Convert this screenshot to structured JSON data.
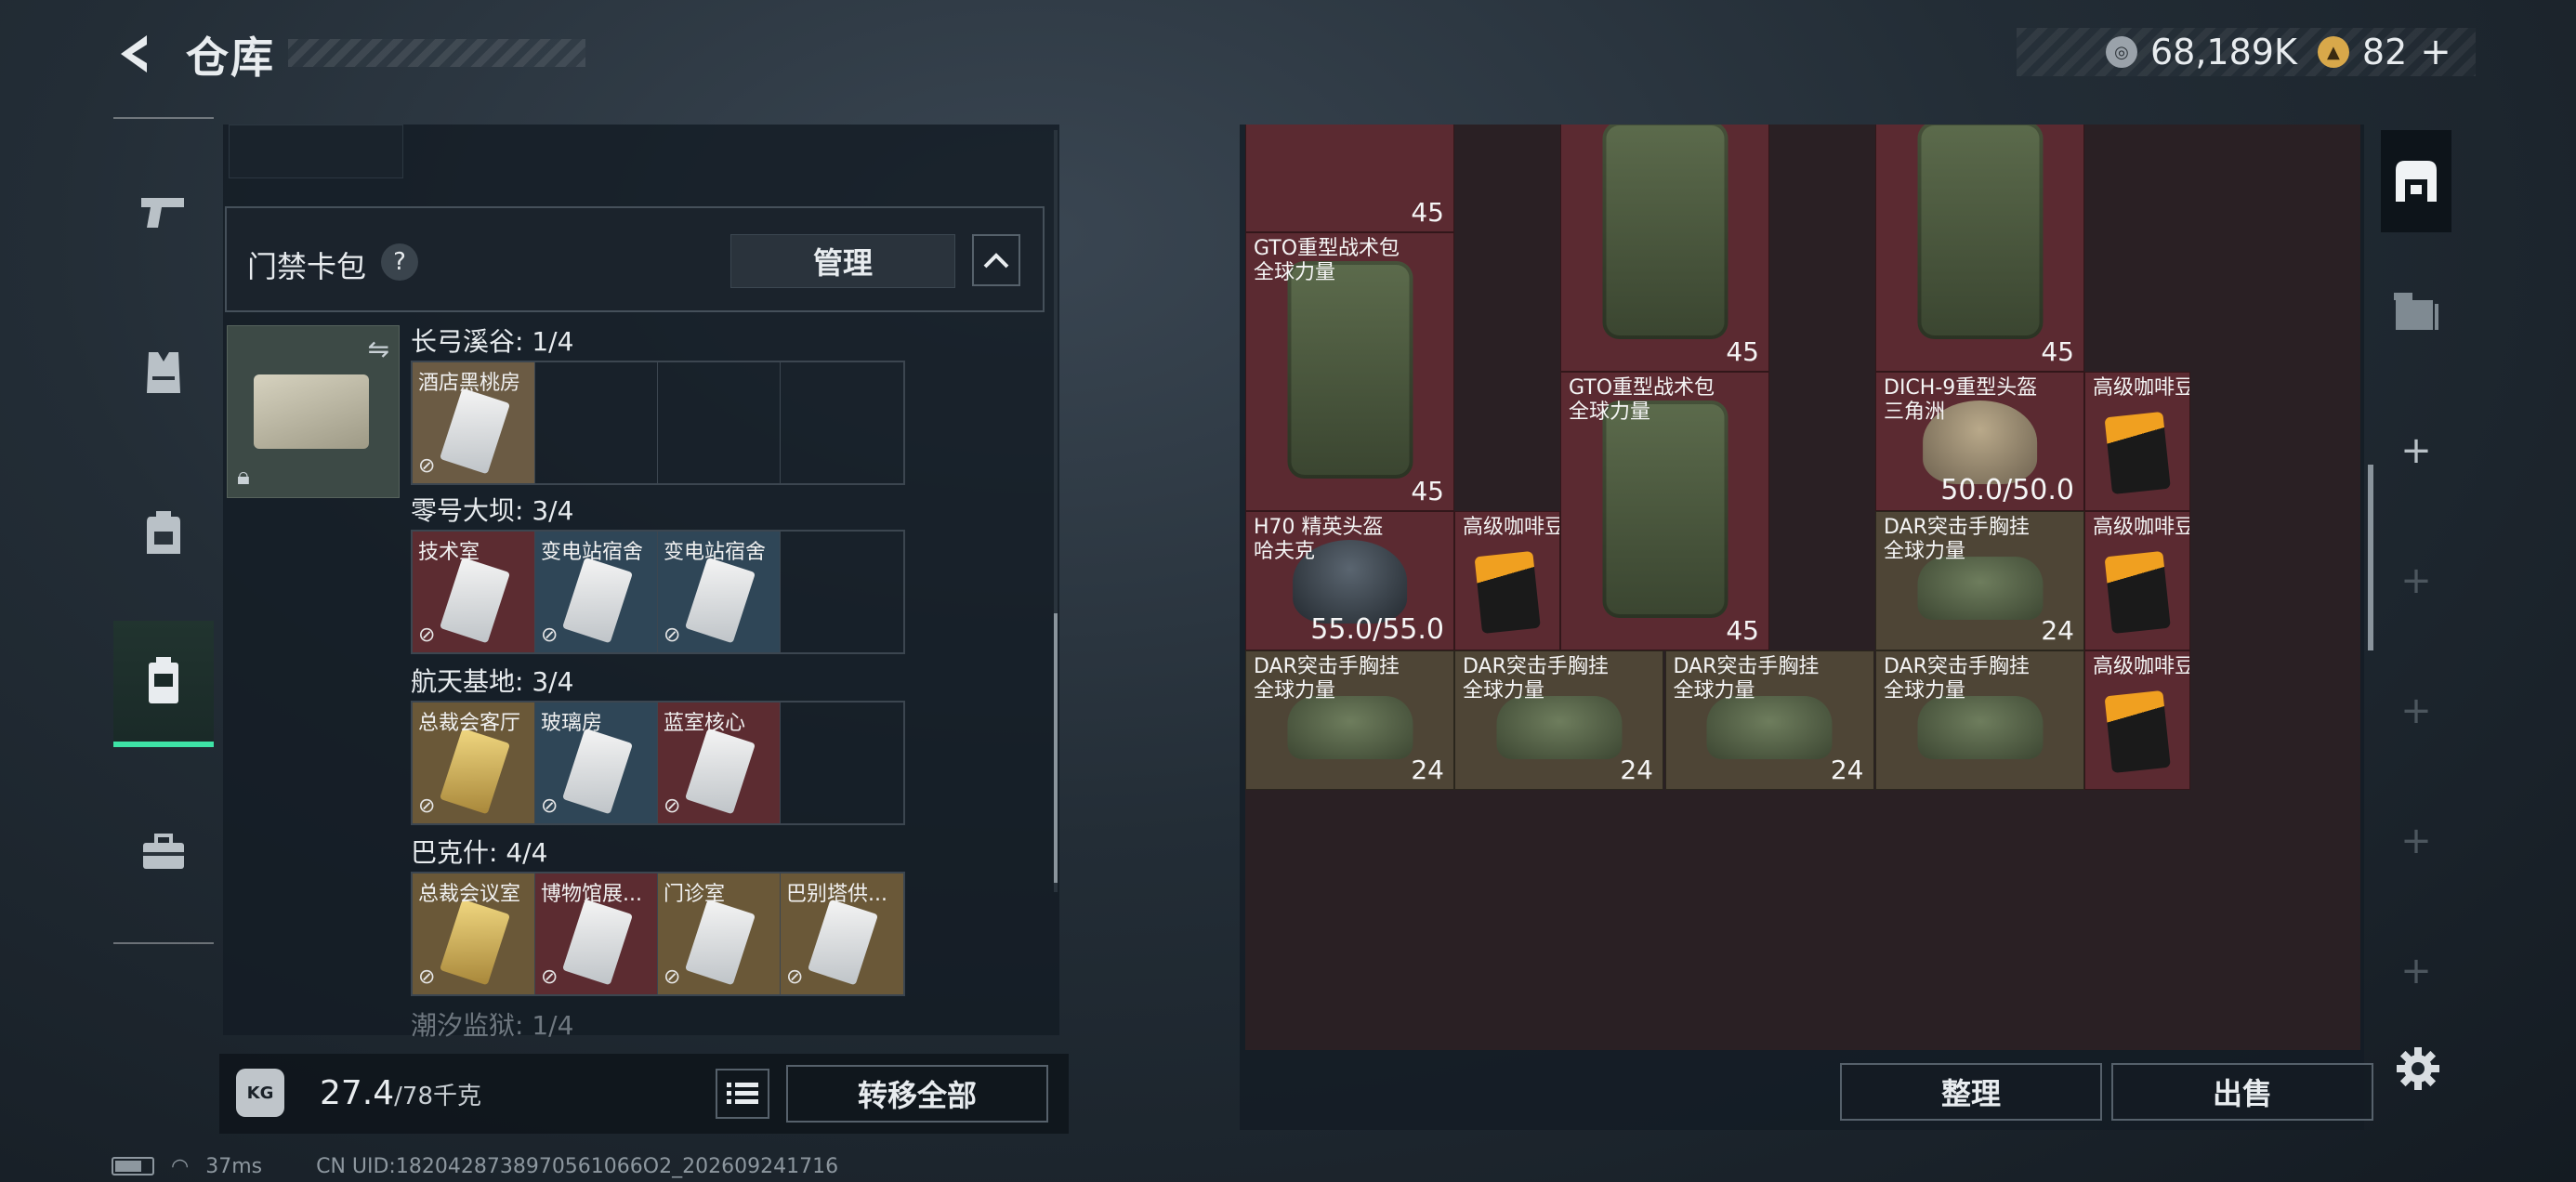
{
  "header": {
    "title": "仓库",
    "currency_1": "68,189K",
    "currency_2": "82",
    "currency_2_add": "+"
  },
  "left_nav": {
    "items": [
      {
        "icon": "pistol-icon"
      },
      {
        "icon": "vest-icon"
      },
      {
        "icon": "backpack-icon"
      },
      {
        "icon": "keycard-case-icon",
        "active": true
      },
      {
        "icon": "toolbox-icon"
      }
    ]
  },
  "keycard": {
    "title": "门禁卡包",
    "help": "?",
    "manage_label": "管理",
    "regions": [
      {
        "label": "长弓溪谷: 1/4",
        "slots": [
          {
            "name": "酒店黑桃房",
            "color": "tan"
          },
          {},
          {},
          {}
        ]
      },
      {
        "label": "零号大坝: 3/4",
        "slots": [
          {
            "name": "技术室",
            "color": "red"
          },
          {
            "name": "变电站宿舍",
            "color": "blue"
          },
          {
            "name": "变电站宿舍",
            "color": "blue"
          },
          {}
        ]
      },
      {
        "label": "航天基地: 3/4",
        "slots": [
          {
            "name": "总裁会客厅",
            "color": "gold",
            "gold": true
          },
          {
            "name": "玻璃房",
            "color": "blue"
          },
          {
            "name": "蓝室核心",
            "color": "red"
          },
          {}
        ]
      },
      {
        "label": "巴克什: 4/4",
        "slots": [
          {
            "name": "总裁会议室",
            "color": "gold",
            "gold": true
          },
          {
            "name": "博物馆展...",
            "color": "red"
          },
          {
            "name": "门诊室",
            "color": "gold"
          },
          {
            "name": "巴别塔供...",
            "color": "gold"
          }
        ]
      },
      {
        "label": "潮汐监狱: 1/4",
        "slots": []
      }
    ]
  },
  "weight": {
    "current": "27.4",
    "max": "/78千克",
    "icon": "KG"
  },
  "buttons": {
    "transfer_all": "转移全部",
    "sort": "整理",
    "sell": "出售"
  },
  "stash": {
    "items": [
      {
        "id": "top-partial",
        "name": "",
        "value": "45",
        "kind": "none",
        "color": "red"
      },
      {
        "id": "bag-1",
        "name": "GTO重型战术包\n全球力量",
        "value": "45",
        "kind": "bag",
        "color": "red"
      },
      {
        "id": "bag-2",
        "name": "",
        "value": "45",
        "kind": "bag",
        "color": "red"
      },
      {
        "id": "bag-3",
        "name": "",
        "value": "45",
        "kind": "bag",
        "color": "red"
      },
      {
        "id": "bag-4",
        "name": "GTO重型战术包\n全球力量",
        "value": "45",
        "kind": "bag",
        "color": "red"
      },
      {
        "id": "helmet-dich",
        "name": "DICH-9重型头盔\n三角洲",
        "value": "50.0/50.0",
        "kind": "helmet-tan",
        "color": "red"
      },
      {
        "id": "coffee-1",
        "name": "高级咖啡豆",
        "value": "",
        "kind": "coffee",
        "color": "red"
      },
      {
        "id": "helmet-h70",
        "name": "H70 精英头盔\n哈夫克",
        "value": "55.0/55.0",
        "kind": "helmet-dark",
        "color": "red"
      },
      {
        "id": "coffee-2",
        "name": "高级咖啡豆",
        "value": "",
        "kind": "coffee",
        "color": "red"
      },
      {
        "id": "vest-1",
        "name": "DAR突击手胸挂\n全球力量",
        "value": "24",
        "kind": "vest",
        "color": "tan"
      },
      {
        "id": "coffee-3",
        "name": "高级咖啡豆",
        "value": "",
        "kind": "coffee",
        "color": "red"
      },
      {
        "id": "vest-2",
        "name": "DAR突击手胸挂\n全球力量",
        "value": "24",
        "kind": "vest",
        "color": "tan"
      },
      {
        "id": "vest-3",
        "name": "DAR突击手胸挂\n全球力量",
        "value": "24",
        "kind": "vest",
        "color": "tan"
      },
      {
        "id": "vest-4",
        "name": "DAR突击手胸挂\n全球力量",
        "value": "24",
        "kind": "vest",
        "color": "tan"
      },
      {
        "id": "vest-5",
        "name": "DAR突击手胸挂\n全球力量",
        "value": "",
        "kind": "vest",
        "color": "tan"
      },
      {
        "id": "coffee-4",
        "name": "高级咖啡豆",
        "value": "",
        "kind": "coffee",
        "color": "red"
      }
    ]
  },
  "right_tabs": {
    "add_label": "+"
  },
  "status": {
    "ping": "37ms",
    "uid": "CN UID:1820428738970561066O2_202609241716"
  }
}
